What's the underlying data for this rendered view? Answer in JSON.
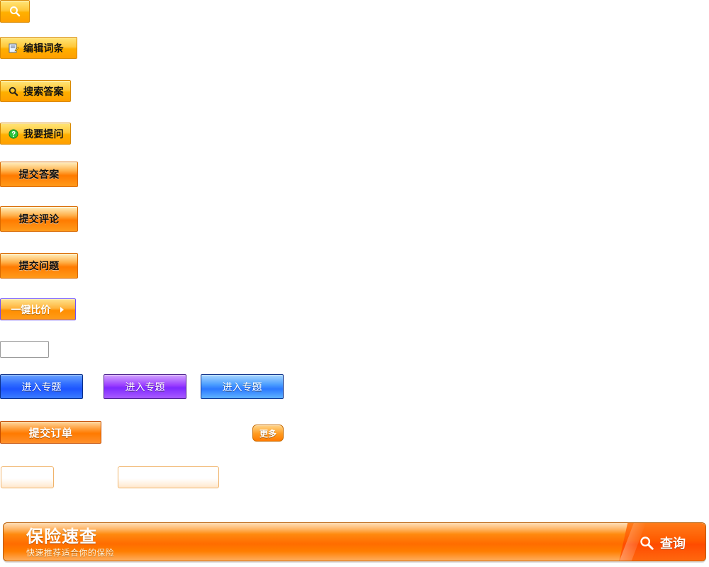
{
  "buttons": {
    "search_icon_only": {
      "icon": "search-icon"
    },
    "edit_entry": {
      "label": "编辑词条",
      "icon": "edit-note-icon"
    },
    "search_answers": {
      "label": "搜索答案",
      "icon": "search-icon"
    },
    "ask_question": {
      "label": "我要提问",
      "icon": "question-icon"
    },
    "submit_answer": {
      "label": "提交答案"
    },
    "submit_comment": {
      "label": "提交评论"
    },
    "submit_question": {
      "label": "提交问题"
    },
    "one_click_compare": {
      "label": "一键比价",
      "icon": "play-icon"
    },
    "topics": [
      {
        "label": "进入专题",
        "variant": "blue"
      },
      {
        "label": "进入专题",
        "variant": "purple"
      },
      {
        "label": "进入专题",
        "variant": "blue2"
      }
    ],
    "submit_order": {
      "label": "提交订单"
    },
    "more": {
      "label": "更多"
    }
  },
  "inputs": {
    "small_plain": {
      "value": "",
      "placeholder": ""
    },
    "orange_small": {
      "value": "",
      "placeholder": ""
    },
    "orange_wide": {
      "value": "",
      "placeholder": ""
    }
  },
  "banner": {
    "title": "保险速查",
    "subtitle": "快速推荐适合你的保险",
    "query_label": "查询",
    "query_icon": "search-icon"
  }
}
